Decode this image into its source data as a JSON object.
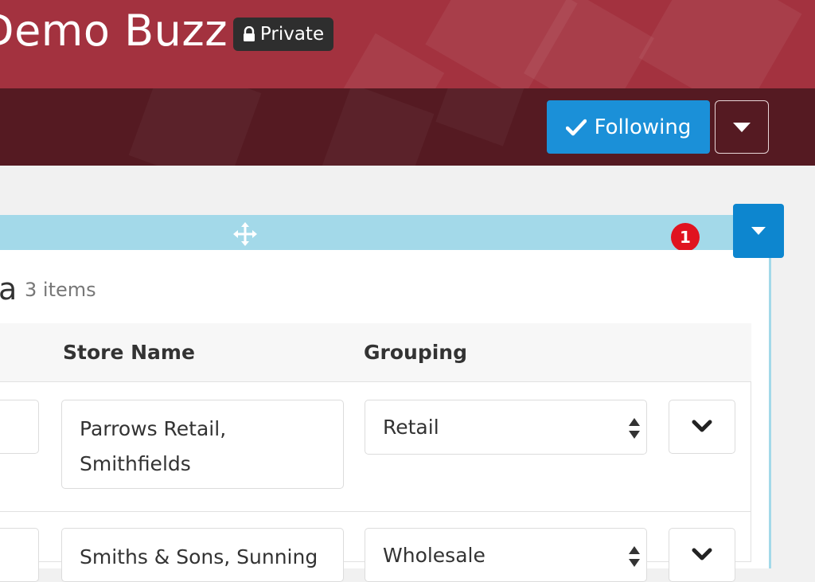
{
  "header": {
    "title": "Demo Buzz",
    "privacy_label": "Private",
    "follow_label": "Following"
  },
  "widget": {
    "notification_count": "1",
    "title_fragment": "a",
    "item_count": "3 items",
    "columns": [
      "Store Name",
      "Grouping"
    ],
    "rows": [
      {
        "store_name": "Parrows Retail, Smithfields",
        "grouping": "Retail"
      },
      {
        "store_name": "Smiths & Sons, Sunning",
        "grouping": "Wholesale"
      }
    ]
  },
  "colors": {
    "header_red": "#a3323f",
    "header_dark": "#551a22",
    "accent_blue": "#1b90d8",
    "drag_bar": "#a3d9e9",
    "badge_red": "#e0131f"
  }
}
